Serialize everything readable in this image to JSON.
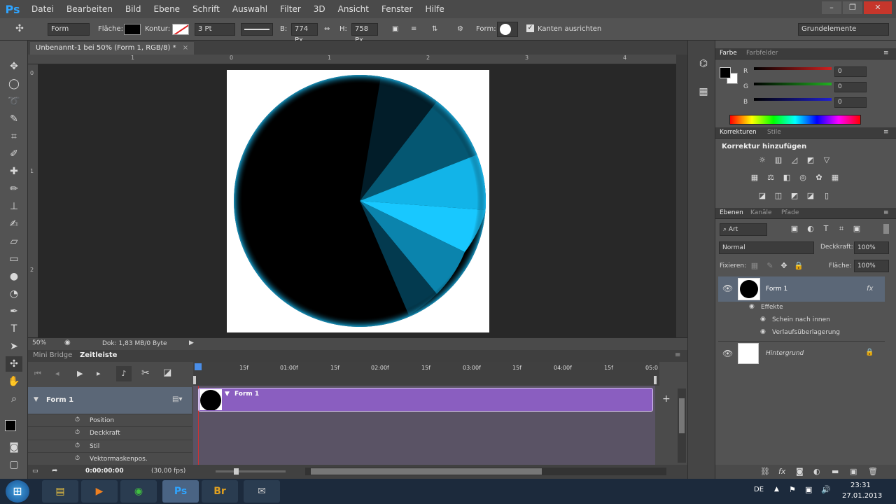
{
  "menubar": {
    "logo": "Ps",
    "items": [
      "Datei",
      "Bearbeiten",
      "Bild",
      "Ebene",
      "Schrift",
      "Auswahl",
      "Filter",
      "3D",
      "Ansicht",
      "Fenster",
      "Hilfe"
    ],
    "window_buttons": [
      "–",
      "❐",
      "✕"
    ]
  },
  "options": {
    "tool_mode": "Form",
    "flaeche_label": "Fläche:",
    "kontur_label": "Kontur:",
    "stroke_width": "3 Pt",
    "w_label": "B:",
    "w_value": "774 Px",
    "h_label": "H:",
    "h_value": "758 Px",
    "form_label": "Form:",
    "align_label": "Kanten ausrichten",
    "workspace": "Grundelemente"
  },
  "document": {
    "tab_title": "Unbenannt-1 bei 50% (Form 1, RGB/8) *",
    "tab_close": "×",
    "ruler_h": [
      "1",
      "0",
      "1",
      "2",
      "3",
      "4"
    ],
    "ruler_v": [
      "0",
      "1",
      "2"
    ],
    "zoom": "50%",
    "doc_info": "Dok: 1,83 MB/0 Byte"
  },
  "timeline": {
    "tabs": [
      "Mini Bridge",
      "Zeitleiste"
    ],
    "marks": [
      "15f",
      "01:00f",
      "15f",
      "02:00f",
      "15f",
      "03:00f",
      "15f",
      "04:00f",
      "15f",
      "05:0"
    ],
    "layer": "Form 1",
    "clip_label": "Form 1",
    "properties": [
      "Position",
      "Deckkraft",
      "Stil",
      "Vektormaskenpos."
    ],
    "time": "0:00:00:00",
    "fps": "(30,00 fps)"
  },
  "color_panel": {
    "tabs": [
      "Farbe",
      "Farbfelder"
    ],
    "channels": [
      {
        "label": "R",
        "value": "0",
        "color": "#d02020"
      },
      {
        "label": "G",
        "value": "0",
        "color": "#20b020"
      },
      {
        "label": "B",
        "value": "0",
        "color": "#2020d0"
      }
    ]
  },
  "adjust_panel": {
    "tabs": [
      "Korrekturen",
      "Stile"
    ],
    "title": "Korrektur hinzufügen"
  },
  "layers_panel": {
    "tabs": [
      "Ebenen",
      "Kanäle",
      "Pfade"
    ],
    "filter": "Art",
    "blend": "Normal",
    "opacity_label": "Deckkraft:",
    "opacity": "100%",
    "lock_label": "Fixieren:",
    "fill_label": "Fläche:",
    "fill": "100%",
    "layers": [
      {
        "name": "Form 1",
        "fx": "fx"
      },
      {
        "name": "Hintergrund"
      }
    ],
    "effects_label": "Effekte",
    "effects": [
      "Schein nach innen",
      "Verlaufsüberlagerung"
    ]
  },
  "taskbar": {
    "lang": "DE",
    "time": "23:31",
    "date": "27.01.2013"
  },
  "colors": {
    "accent": "#2fa4ff",
    "clip": "#8a5ec0",
    "cyan": "#18c8ff"
  }
}
